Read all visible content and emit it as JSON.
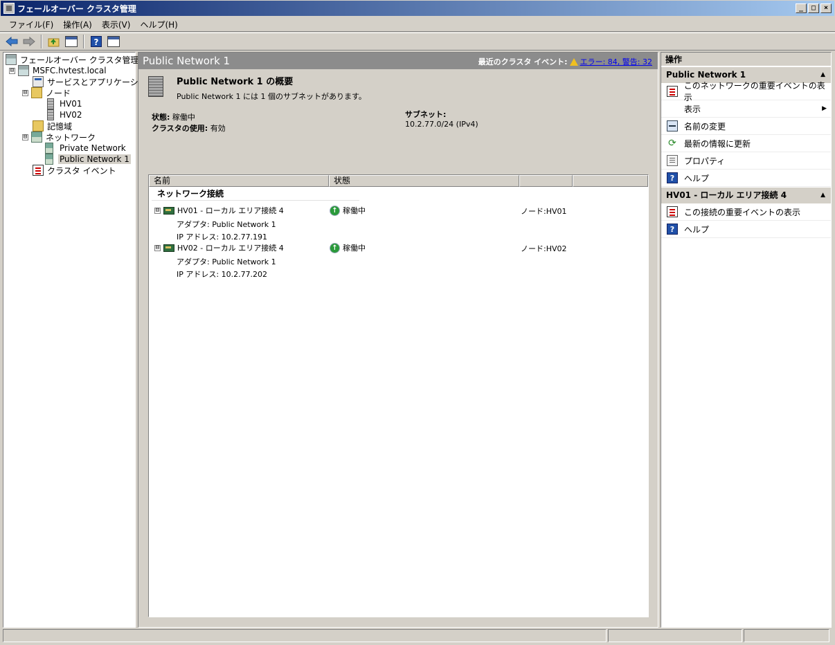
{
  "window": {
    "title": "フェールオーバー クラスタ管理",
    "buttons": [
      "_",
      "□",
      "×"
    ]
  },
  "menu": [
    "ファイル(F)",
    "操作(A)",
    "表示(V)",
    "ヘルプ(H)"
  ],
  "toolbar": {
    "icons": [
      "back-arrow-icon",
      "forward-arrow-icon",
      "up-folder-icon",
      "show-hide-console-tree-icon",
      "help-icon",
      "show-hide-action-pane-icon"
    ]
  },
  "tree": {
    "root": "フェールオーバー クラスタ管理",
    "cluster": "MSFC.hvtest.local",
    "services": "サービスとアプリケーション",
    "nodes": "ノード",
    "node1": "HV01",
    "node2": "HV02",
    "storage": "記憶域",
    "networks": "ネットワーク",
    "private_net": "Private Network",
    "public_net": "Public Network 1",
    "cluster_events": "クラスタ イベント",
    "expander": "⊟"
  },
  "center": {
    "header_title": "Public Network 1",
    "recent_events_label": "最近のクラスタ イベント:",
    "recent_events_link": "エラー: 84, 警告: 32",
    "summary_title": "Public Network 1 の概要",
    "summary_subtitle": "Public Network 1 には 1 個のサブネットがあります。",
    "status_key": "状態:",
    "status_value": "稼働中",
    "cluster_use_key": "クラスタの使用:",
    "cluster_use_value": "有効",
    "subnet_key": "サブネット:",
    "subnet_value": "10.2.77.0/24 (IPv4)",
    "columns": [
      "名前",
      "状態",
      "",
      ""
    ],
    "group_label": "ネットワーク接続",
    "connections": [
      {
        "name": "HV01 - ローカル エリア接続 4",
        "status": "稼働中",
        "node": "ノード:HV01",
        "adapter": "アダプタ: Public Network 1",
        "ip": "IP アドレス: 10.2.77.191"
      },
      {
        "name": "HV02 - ローカル エリア接続 4",
        "status": "稼働中",
        "node": "ノード:HV02",
        "adapter": "アダプタ: Public Network 1",
        "ip": "IP アドレス: 10.2.77.202"
      }
    ]
  },
  "actions": {
    "title": "操作",
    "section1": "Public Network 1",
    "section1_items": [
      {
        "label": "このネットワークの重要イベントの表示",
        "icon": "events-icon"
      },
      {
        "label": "表示",
        "icon": "",
        "submenu": "▶"
      },
      {
        "label": "名前の変更",
        "icon": "rename-icon"
      },
      {
        "label": "最新の情報に更新",
        "icon": "refresh-icon"
      },
      {
        "label": "プロパティ",
        "icon": "properties-icon"
      },
      {
        "label": "ヘルプ",
        "icon": "help-icon"
      }
    ],
    "section2": "HV01 - ローカル エリア接続 4",
    "section2_items": [
      {
        "label": "この接続の重要イベントの表示",
        "icon": "events-icon"
      },
      {
        "label": "ヘルプ",
        "icon": "help-icon"
      }
    ],
    "collapse_glyph": "▲"
  }
}
